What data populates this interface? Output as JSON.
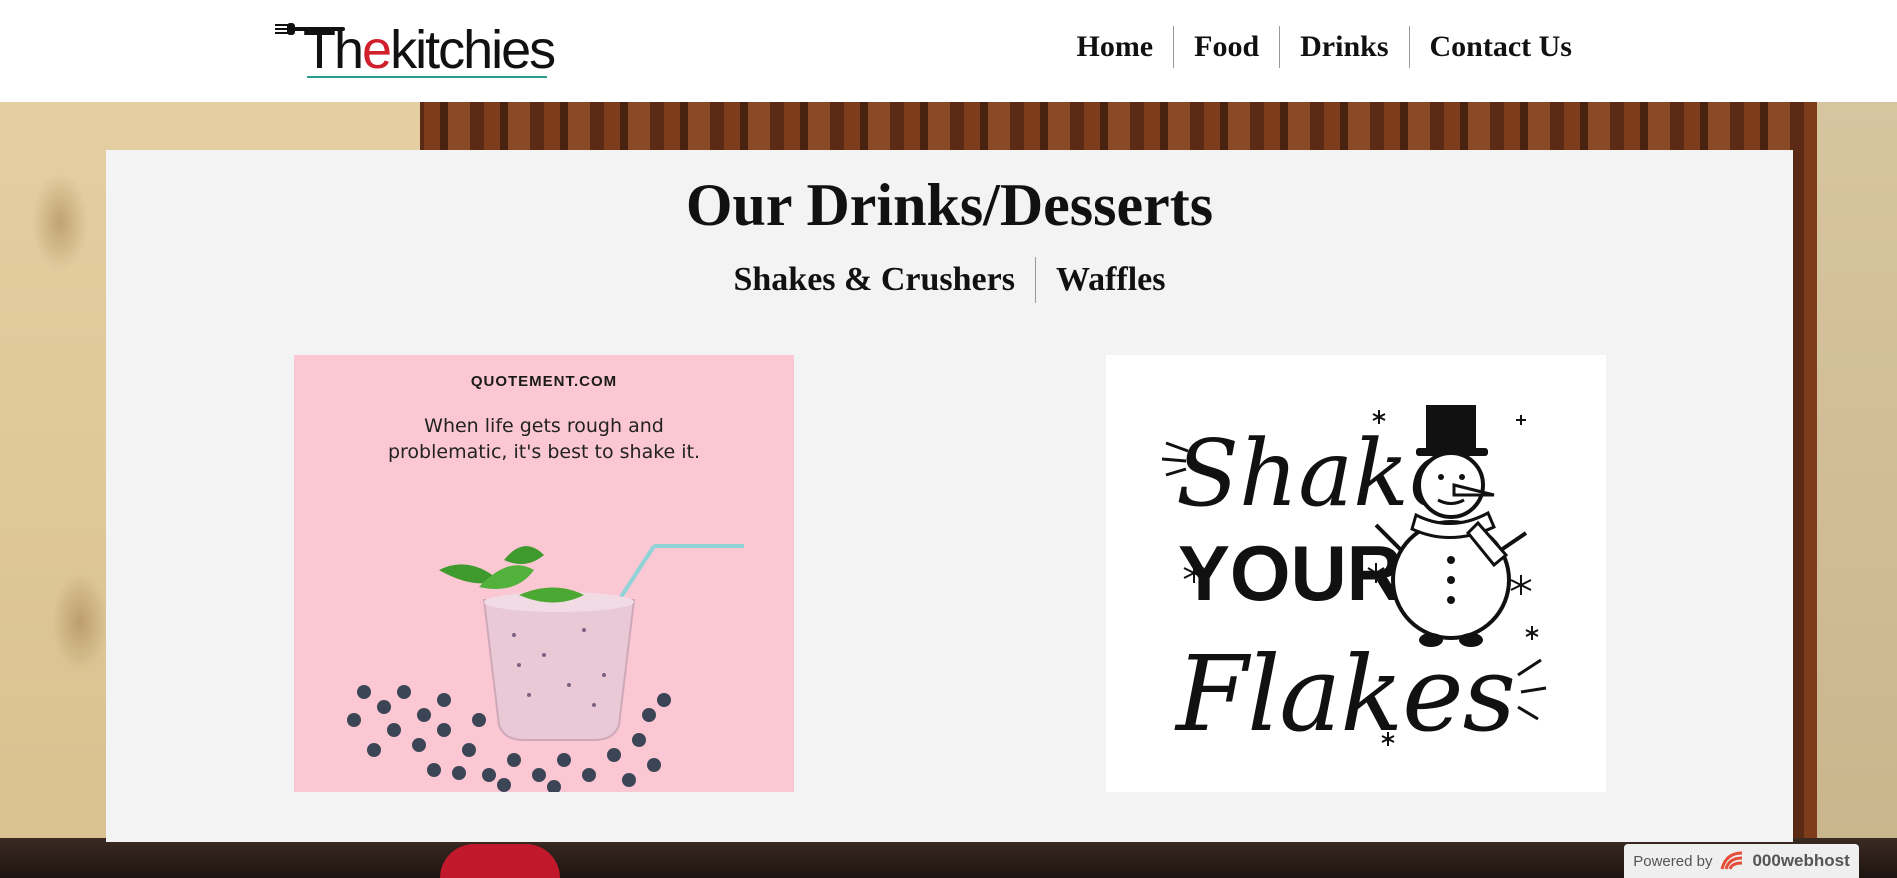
{
  "header": {
    "logo_text_the": "The",
    "logo_text_kitchies": "kitchies",
    "nav": [
      {
        "label": "Home"
      },
      {
        "label": "Food"
      },
      {
        "label": "Drinks"
      },
      {
        "label": "Contact Us"
      }
    ]
  },
  "main": {
    "title": "Our Drinks/Desserts",
    "tabs": [
      {
        "label": "Shakes & Crushers"
      },
      {
        "label": "Waffles"
      }
    ],
    "cards": [
      {
        "site": "QUOTEMENT.COM",
        "quote": "When life gets rough and problematic, it's best to shake it.",
        "image": "smoothie-with-blueberries"
      },
      {
        "art_words": [
          "Shake",
          "YOUR",
          "Flakes"
        ],
        "image": "snowman-illustration"
      }
    ]
  },
  "footer": {
    "powered_label": "Powered by",
    "powered_brand": "000webhost"
  },
  "colors": {
    "panel_bg": "#f3f3f3",
    "card_pink": "#fac7d3",
    "logo_red": "#d0202e",
    "logo_underline": "#2a9d8f"
  }
}
